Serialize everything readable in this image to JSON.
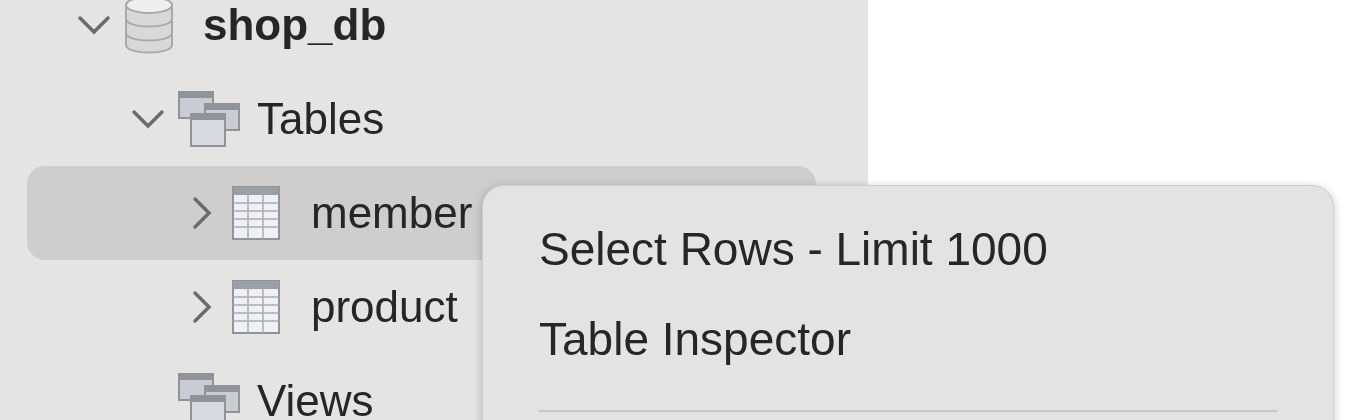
{
  "tree": [
    {
      "label": "shop_db",
      "kind": "database",
      "expanded": true,
      "selected": false,
      "children": [
        {
          "label": "Tables",
          "kind": "folder",
          "expanded": true,
          "selected": false,
          "children": [
            {
              "label": "member",
              "kind": "table",
              "expanded": false,
              "selected": true
            },
            {
              "label": "product",
              "kind": "table",
              "expanded": false,
              "selected": false
            }
          ]
        },
        {
          "label": "Views",
          "kind": "folder",
          "selected": false
        }
      ]
    }
  ],
  "context_menu": {
    "items": [
      {
        "label": "Select Rows - Limit 1000",
        "kind": "item"
      },
      {
        "label": "Table Inspector",
        "kind": "item"
      },
      {
        "kind": "separator"
      }
    ]
  }
}
